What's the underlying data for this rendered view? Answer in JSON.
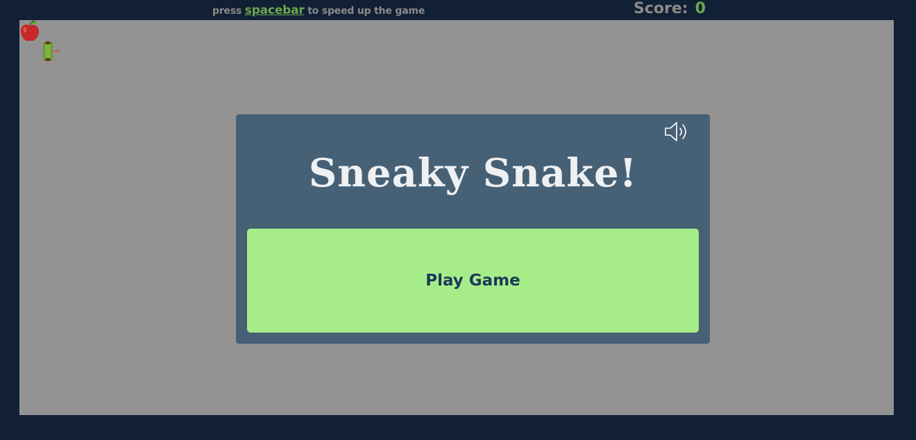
{
  "header": {
    "hint_prefix": "press",
    "hint_key": "spacebar",
    "hint_suffix": "to speed up the game",
    "score_label": "Score:",
    "score_value": "0"
  },
  "board": {
    "items": [
      "apple-icon",
      "snake-head-icon"
    ]
  },
  "modal": {
    "title": "Sneaky Snake!",
    "play_label": "Play Game",
    "sound_icon": "speaker-icon"
  },
  "colors": {
    "page_bg": "#112035",
    "board_bg": "#939393",
    "modal_bg": "#466075",
    "play_bg": "#a6ed8a",
    "accent_green": "#6aa84f",
    "play_text": "#1c3a56"
  }
}
